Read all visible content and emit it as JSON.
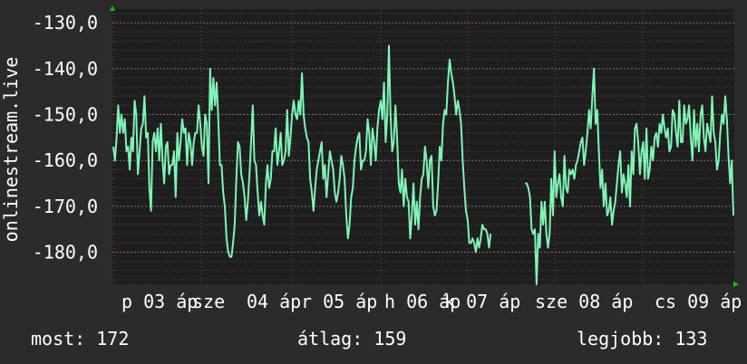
{
  "chart_data": {
    "type": "line",
    "title": "",
    "ylabel": "onlinestream.live",
    "xlabel": "",
    "ylim": [
      -187,
      -127
    ],
    "y_ticks": [
      "-130,0",
      "-140,0",
      "-150,0",
      "-160,0",
      "-170,0",
      "-180,0"
    ],
    "y_tick_values": [
      -130,
      -140,
      -150,
      -160,
      -170,
      -180
    ],
    "x_ticks": [
      "p 03 áp",
      "sze",
      "04 áp",
      "r 05 áp",
      "h 06 áp",
      "k 07 áp",
      "sze 08 áp",
      "cs 09 áp"
    ],
    "grid": true,
    "colors": {
      "background": "#2b2b2b",
      "plot": "#1e1e1e",
      "line": "#7ff5b4",
      "grid": "#5a5a5a",
      "axis_arrow": "#00cc00"
    },
    "series": [
      {
        "values": [
          -157,
          -160,
          -155,
          -148,
          -154,
          -150,
          -154,
          -151,
          -158,
          -157,
          -162,
          -155,
          -158,
          -147,
          -150,
          -163,
          -158,
          -153,
          -152,
          -146,
          -155,
          -154,
          -166,
          -171,
          -156,
          -154,
          -158,
          -153,
          -160,
          -152,
          -160,
          -165,
          -157,
          -156,
          -163,
          -161,
          -161,
          -158,
          -168,
          -154,
          -160,
          -156,
          -151,
          -154,
          -153,
          -161,
          -154,
          -156,
          -161,
          -156,
          -154,
          -154,
          -148,
          -152,
          -157,
          -159,
          -150,
          -152,
          -165,
          -140,
          -149,
          -142,
          -148,
          -143,
          -151,
          -161,
          -161,
          -167,
          -170,
          -177,
          -180,
          -181,
          -181,
          -178,
          -174,
          -164,
          -156,
          -157,
          -163,
          -165,
          -168,
          -173,
          -169,
          -163,
          -156,
          -148,
          -160,
          -161,
          -167,
          -172,
          -169,
          -172,
          -174,
          -165,
          -161,
          -166,
          -164,
          -158,
          -158,
          -153,
          -161,
          -158,
          -154,
          -161,
          -160,
          -158,
          -149,
          -159,
          -155,
          -150,
          -147,
          -150,
          -151,
          -147,
          -150,
          -141,
          -150,
          -153,
          -155,
          -156,
          -164,
          -167,
          -171,
          -166,
          -162,
          -160,
          -158,
          -156,
          -164,
          -161,
          -168,
          -163,
          -158,
          -160,
          -162,
          -167,
          -169,
          -167,
          -164,
          -159,
          -161,
          -164,
          -172,
          -177,
          -174,
          -168,
          -166,
          -160,
          -157,
          -155,
          -154,
          -162,
          -160,
          -160,
          -158,
          -151,
          -154,
          -161,
          -153,
          -156,
          -160,
          -153,
          -149,
          -147,
          -151,
          -143,
          -156,
          -150,
          -135,
          -150,
          -158,
          -156,
          -148,
          -155,
          -165,
          -167,
          -162,
          -170,
          -164,
          -168,
          -169,
          -177,
          -172,
          -165,
          -174,
          -169,
          -175,
          -168,
          -164,
          -163,
          -157,
          -160,
          -166,
          -160,
          -159,
          -170,
          -172,
          -171,
          -165,
          -157,
          -160,
          -152,
          -149,
          -150,
          -143,
          -138,
          -141,
          -143,
          -146,
          -150,
          -147,
          -149,
          -152,
          -160,
          -166,
          -171,
          -173,
          -178,
          -178,
          -177,
          -178,
          -180,
          -177,
          -179,
          -177,
          -174,
          -175,
          -175,
          -176,
          -179,
          -176
        ],
        "breaks_after_index": 230,
        "values_after_gap": [
          -165,
          -165,
          -166,
          -168,
          -175,
          -176,
          -175,
          -187,
          -176,
          -179,
          -169,
          -174,
          -169,
          -176,
          -179,
          -176,
          -164,
          -172,
          -158,
          -168,
          -165,
          -163,
          -168,
          -170,
          -159,
          -166,
          -167,
          -162,
          -163,
          -162,
          -164,
          -161,
          -160,
          -158,
          -156,
          -155,
          -161,
          -158,
          -154,
          -149,
          -153,
          -146,
          -140,
          -152,
          -149,
          -158,
          -166,
          -162,
          -170,
          -165,
          -172,
          -171,
          -168,
          -174,
          -171,
          -169,
          -165,
          -161,
          -158,
          -167,
          -163,
          -165,
          -168,
          -161,
          -170,
          -158,
          -163,
          -153,
          -152,
          -156,
          -163,
          -158,
          -156,
          -164,
          -153,
          -164,
          -162,
          -157,
          -160,
          -155,
          -154,
          -157,
          -152,
          -154,
          -150,
          -153,
          -155,
          -153,
          -158,
          -157,
          -149,
          -150,
          -154,
          -157,
          -147,
          -156,
          -156,
          -148,
          -152,
          -151,
          -148,
          -155,
          -160,
          -149,
          -157,
          -152,
          -158,
          -150,
          -148,
          -155,
          -158,
          -152,
          -154,
          -156,
          -146,
          -154,
          -156,
          -162,
          -160,
          -154,
          -150,
          -152,
          -146,
          -151,
          -159,
          -165,
          -160,
          -172
        ]
      }
    ]
  },
  "stats": {
    "current": "most: 172",
    "average": "átlag: 159",
    "best": "legjobb: 133"
  }
}
